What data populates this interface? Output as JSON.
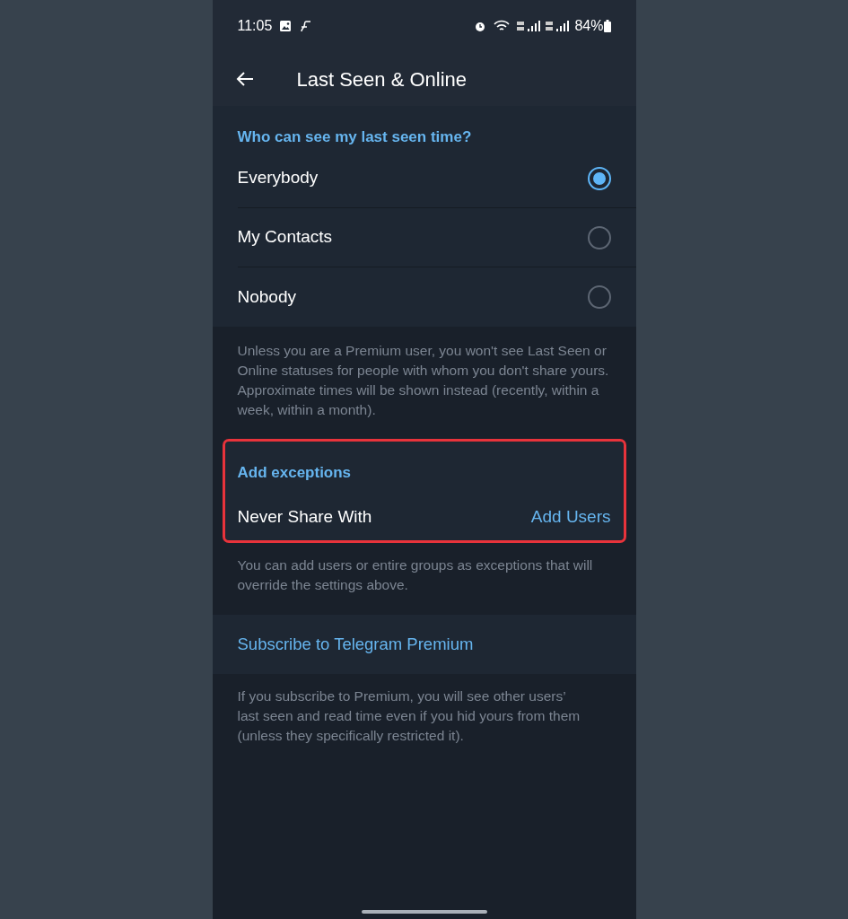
{
  "status_bar": {
    "time": "11:05",
    "battery": "84%"
  },
  "header": {
    "title": "Last Seen & Online"
  },
  "visibility": {
    "heading": "Who can see my last seen time?",
    "options": [
      {
        "label": "Everybody",
        "selected": true
      },
      {
        "label": "My Contacts",
        "selected": false
      },
      {
        "label": "Nobody",
        "selected": false
      }
    ],
    "note": "Unless you are a Premium user, you won't see Last Seen or Online statuses for people with whom you don't share yours. Approximate times will be shown instead (recently, within a week, within a month)."
  },
  "exceptions": {
    "heading": "Add exceptions",
    "highlighted": true,
    "rows": [
      {
        "label": "Never Share With",
        "action": "Add Users"
      }
    ],
    "note": "You can add users or entire groups as exceptions that will override the settings above."
  },
  "premium": {
    "link": "Subscribe to Telegram Premium",
    "note": "If you subscribe to Premium, you will see other users’ last seen and read time even if you hid yours from them (unless they specifically restricted it)."
  }
}
